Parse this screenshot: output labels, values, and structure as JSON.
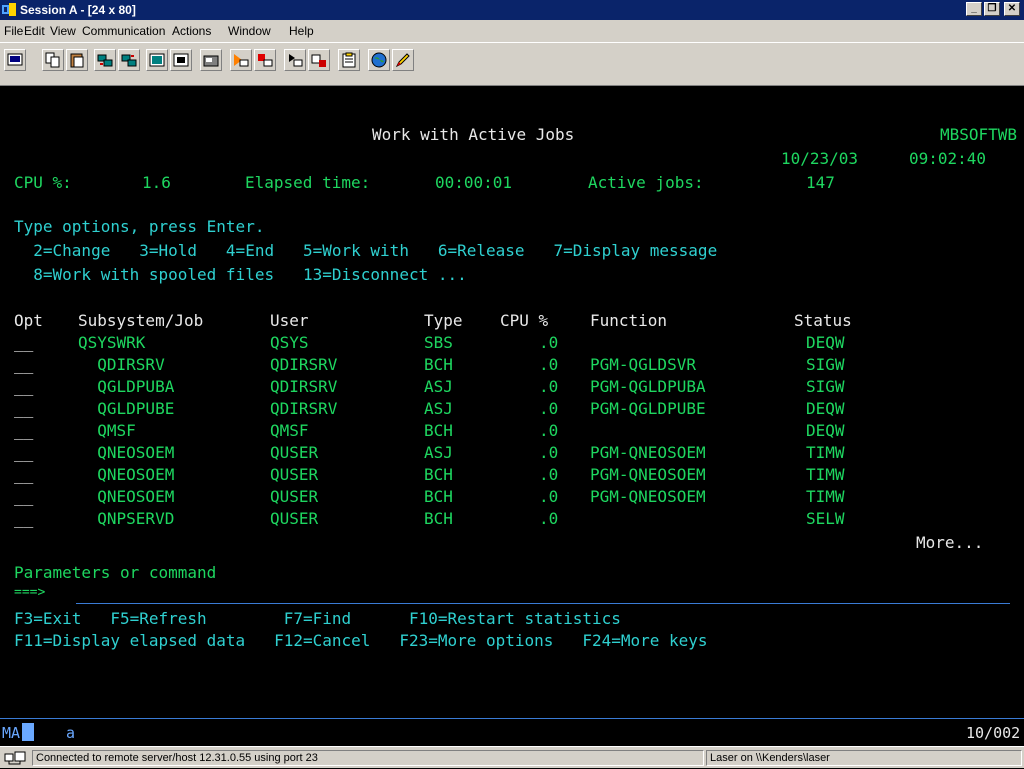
{
  "window": {
    "title": "Session A - [24 x 80]",
    "icon": "session-icon",
    "controls": [
      "minimize",
      "restore",
      "close"
    ]
  },
  "menu": [
    "File",
    "Edit",
    "View",
    "Communication",
    "Actions",
    "Window",
    "Help"
  ],
  "toolbar_icons": [
    "print-screen-icon",
    "copy-icon",
    "paste-icon",
    "send-icon",
    "receive-icon",
    "display-icon",
    "keypad-icon",
    "macro-icon",
    "record-icon",
    "stop-icon",
    "play-icon",
    "pause-icon",
    "clipboard-icon",
    "globe-icon",
    "edit-pen-icon"
  ],
  "screen": {
    "title": "Work with Active Jobs",
    "system": "MBSOFTWB",
    "date": "10/23/03",
    "time": "09:02:40",
    "cpu_label": "CPU %:",
    "cpu_value": "1.6",
    "elapsed_label": "Elapsed time:",
    "elapsed_value": "00:00:01",
    "active_label": "Active jobs:",
    "active_value": "147",
    "instructions": "Type options, press Enter.",
    "options_line1": "  2=Change   3=Hold   4=End   5=Work with   6=Release   7=Display message",
    "options_line2": "  8=Work with spooled files   13=Disconnect ...",
    "columns": {
      "opt": "Opt",
      "job": "Subsystem/Job",
      "user": "User",
      "type": "Type",
      "cpu": "CPU %",
      "function": "Function",
      "status": "Status"
    },
    "rows": [
      {
        "opt": "__",
        "job": "QSYSWRK",
        "user": "QSYS",
        "type": "SBS",
        "cpu": ".0",
        "function": "",
        "status": "DEQW"
      },
      {
        "opt": "__",
        "job": "  QDIRSRV",
        "user": "QDIRSRV",
        "type": "BCH",
        "cpu": ".0",
        "function": "PGM-QGLDSVR",
        "status": "SIGW"
      },
      {
        "opt": "__",
        "job": "  QGLDPUBA",
        "user": "QDIRSRV",
        "type": "ASJ",
        "cpu": ".0",
        "function": "PGM-QGLDPUBA",
        "status": "SIGW"
      },
      {
        "opt": "__",
        "job": "  QGLDPUBE",
        "user": "QDIRSRV",
        "type": "ASJ",
        "cpu": ".0",
        "function": "PGM-QGLDPUBE",
        "status": "DEQW"
      },
      {
        "opt": "__",
        "job": "  QMSF",
        "user": "QMSF",
        "type": "BCH",
        "cpu": ".0",
        "function": "",
        "status": "DEQW"
      },
      {
        "opt": "__",
        "job": "  QNEOSOEM",
        "user": "QUSER",
        "type": "ASJ",
        "cpu": ".0",
        "function": "PGM-QNEOSOEM",
        "status": "TIMW"
      },
      {
        "opt": "__",
        "job": "  QNEOSOEM",
        "user": "QUSER",
        "type": "BCH",
        "cpu": ".0",
        "function": "PGM-QNEOSOEM",
        "status": "TIMW"
      },
      {
        "opt": "__",
        "job": "  QNEOSOEM",
        "user": "QUSER",
        "type": "BCH",
        "cpu": ".0",
        "function": "PGM-QNEOSOEM",
        "status": "TIMW"
      },
      {
        "opt": "__",
        "job": "  QNPSERVD",
        "user": "QUSER",
        "type": "BCH",
        "cpu": ".0",
        "function": "",
        "status": "SELW"
      }
    ],
    "more": "More...",
    "params_label": "Parameters or command",
    "prompt": "===>",
    "fkeys_line1": "F3=Exit   F5=Refresh        F7=Find      F10=Restart statistics",
    "fkeys_line2": "F11=Display elapsed data   F12=Cancel   F23=More options   F24=More keys"
  },
  "oia": {
    "indicator": "MA",
    "cursor_flag": "a",
    "position": "10/002"
  },
  "statusbar": {
    "connection": "Connected to remote server/host 12.31.0.55 using port 23",
    "printer": "Laser on \\\\Kenders\\laser"
  },
  "colors": {
    "background": "#000000",
    "protected_text": "#1ed760",
    "field_text": "#e8e8e8",
    "column_headings": "#e8e8e8",
    "fkeys": "#2fd0d0",
    "window_title": "#0a246a"
  }
}
